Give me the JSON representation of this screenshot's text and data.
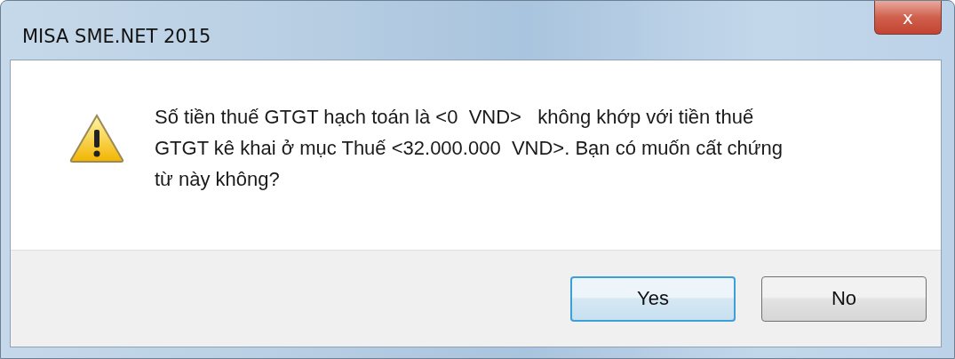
{
  "window": {
    "title": "MISA SME.NET 2015",
    "close_icon": "x"
  },
  "message": {
    "text": "Số tiền thuế GTGT hạch toán là <0  VND>   không khớp với tiền thuế GTGT kê khai ở mục Thuế <32.000.000  VND>. Bạn có muốn cất chứng từ này không?"
  },
  "buttons": [
    {
      "label": "Yes",
      "default": true
    },
    {
      "label": "No",
      "default": false
    }
  ]
}
